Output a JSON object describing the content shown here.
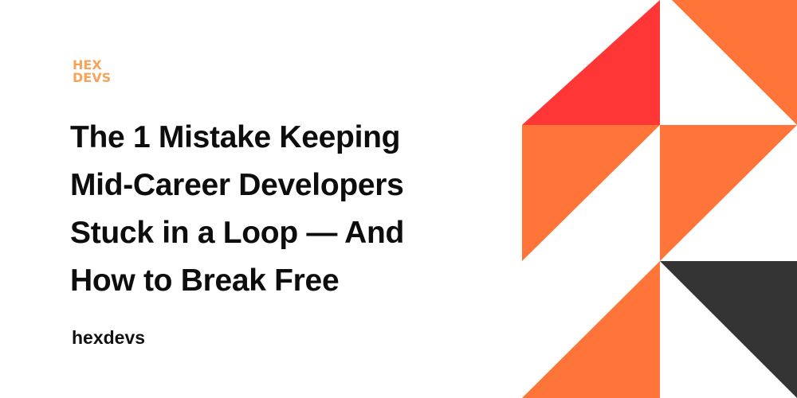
{
  "brand": {
    "logo_line1": "HEX",
    "logo_line2": "DEVS",
    "accent_color": "#F7A45A"
  },
  "article": {
    "title_lines": [
      "The 1 Mistake Keeping",
      "Mid-Career Developers",
      "Stuck in a Loop — And",
      "How to Break Free"
    ],
    "author": "hexdevs"
  },
  "pattern_colors": {
    "orange": "#FF7438",
    "red": "#FF3636",
    "dark": "#333333",
    "white": "#ffffff"
  }
}
